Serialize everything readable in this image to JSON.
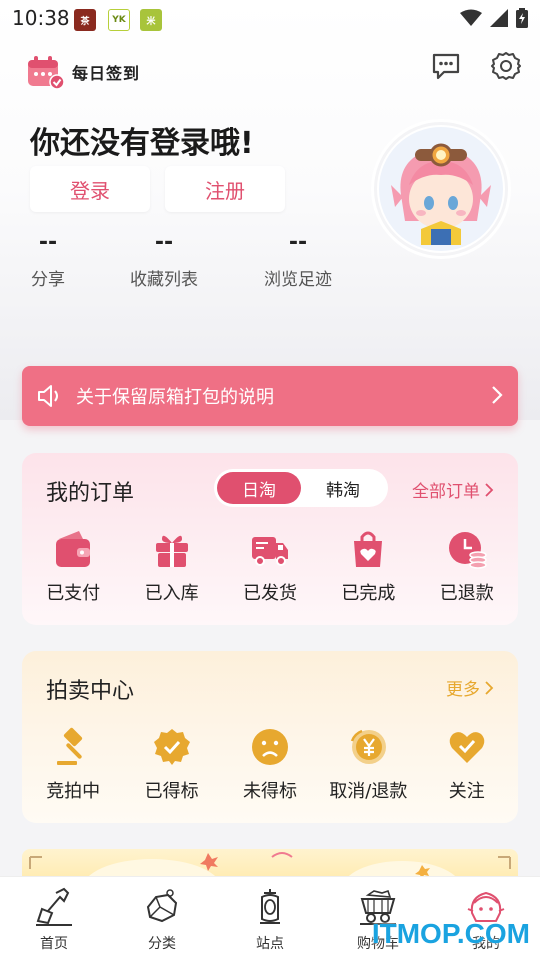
{
  "status_bar": {
    "time": "10:38"
  },
  "header": {
    "sign_label": "每日签到"
  },
  "login": {
    "title": "你还没有登录哦!",
    "login_btn": "登录",
    "register_btn": "注册"
  },
  "stats": [
    {
      "value": "--",
      "label": "分享"
    },
    {
      "value": "--",
      "label": "收藏列表"
    },
    {
      "value": "--",
      "label": "浏览足迹"
    }
  ],
  "notice": {
    "text": "关于保留原箱打包的说明"
  },
  "orders": {
    "title": "我的订单",
    "toggle": [
      "日淘",
      "韩淘"
    ],
    "more": "全部订单",
    "items": [
      {
        "label": "已支付",
        "icon": "wallet-icon"
      },
      {
        "label": "已入库",
        "icon": "gift-icon"
      },
      {
        "label": "已发货",
        "icon": "truck-icon"
      },
      {
        "label": "已完成",
        "icon": "bag-heart-icon"
      },
      {
        "label": "已退款",
        "icon": "refund-icon"
      }
    ]
  },
  "auction": {
    "title": "拍卖中心",
    "more": "更多",
    "items": [
      {
        "label": "竞拍中",
        "icon": "gavel-icon"
      },
      {
        "label": "已得标",
        "icon": "check-badge-icon"
      },
      {
        "label": "未得标",
        "icon": "sad-face-icon"
      },
      {
        "label": "取消/退款",
        "icon": "yen-coin-icon"
      },
      {
        "label": "关注",
        "icon": "heart-check-icon"
      }
    ]
  },
  "bottom_nav": [
    {
      "label": "首页",
      "icon": "shovel-icon"
    },
    {
      "label": "分类",
      "icon": "ore-icon"
    },
    {
      "label": "站点",
      "icon": "lantern-icon"
    },
    {
      "label": "购物车",
      "icon": "mine-cart-icon"
    },
    {
      "label": "我的",
      "icon": "profile-avatar-icon"
    }
  ],
  "watermark": "ITMOP.COM",
  "colors": {
    "accent": "#e0506f",
    "notice": "#ef7085",
    "auction_accent": "#e7a82f"
  }
}
